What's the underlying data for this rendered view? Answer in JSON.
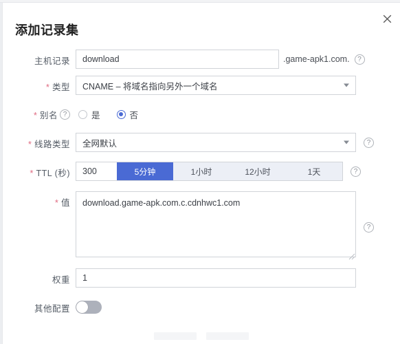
{
  "dialog": {
    "title": "添加记录集",
    "close_icon": "close-icon"
  },
  "fields": {
    "host_record": {
      "label": "主机记录",
      "required": false,
      "value": "download",
      "placeholder": "",
      "suffix": ".game-apk1.com.",
      "help_icon": "help-circle-icon"
    },
    "type": {
      "label": "类型",
      "required": true,
      "value": "CNAME – 将域名指向另外一个域名",
      "caret_icon": "chevron-down-icon"
    },
    "alias": {
      "label": "别名",
      "required": true,
      "help_icon": "help-circle-icon",
      "options": [
        {
          "label": "是",
          "checked": false
        },
        {
          "label": "否",
          "checked": true
        }
      ]
    },
    "line_type": {
      "label": "线路类型",
      "required": true,
      "value": "全网默认",
      "caret_icon": "chevron-down-icon",
      "help_icon": "help-circle-icon"
    },
    "ttl": {
      "label": "TTL (秒)",
      "required": true,
      "value": "300",
      "help_icon": "help-circle-icon",
      "presets": [
        {
          "label": "5分钟",
          "active": true
        },
        {
          "label": "1小时",
          "active": false
        },
        {
          "label": "12小时",
          "active": false
        },
        {
          "label": "1天",
          "active": false
        }
      ]
    },
    "value": {
      "label": "值",
      "required": true,
      "value": "download.game-apk.com.c.cdnhwc1.com",
      "help_icon": "help-circle-icon"
    },
    "weight": {
      "label": "权重",
      "required": false,
      "value": "1"
    },
    "other_config": {
      "label": "其他配置",
      "toggle_on": false
    }
  },
  "colors": {
    "accent": "#4a6ad4",
    "segment_bg": "#eceff6",
    "required_star": "#e06b82",
    "border": "#d0d3d8",
    "toggle_off": "#adb1bb"
  }
}
